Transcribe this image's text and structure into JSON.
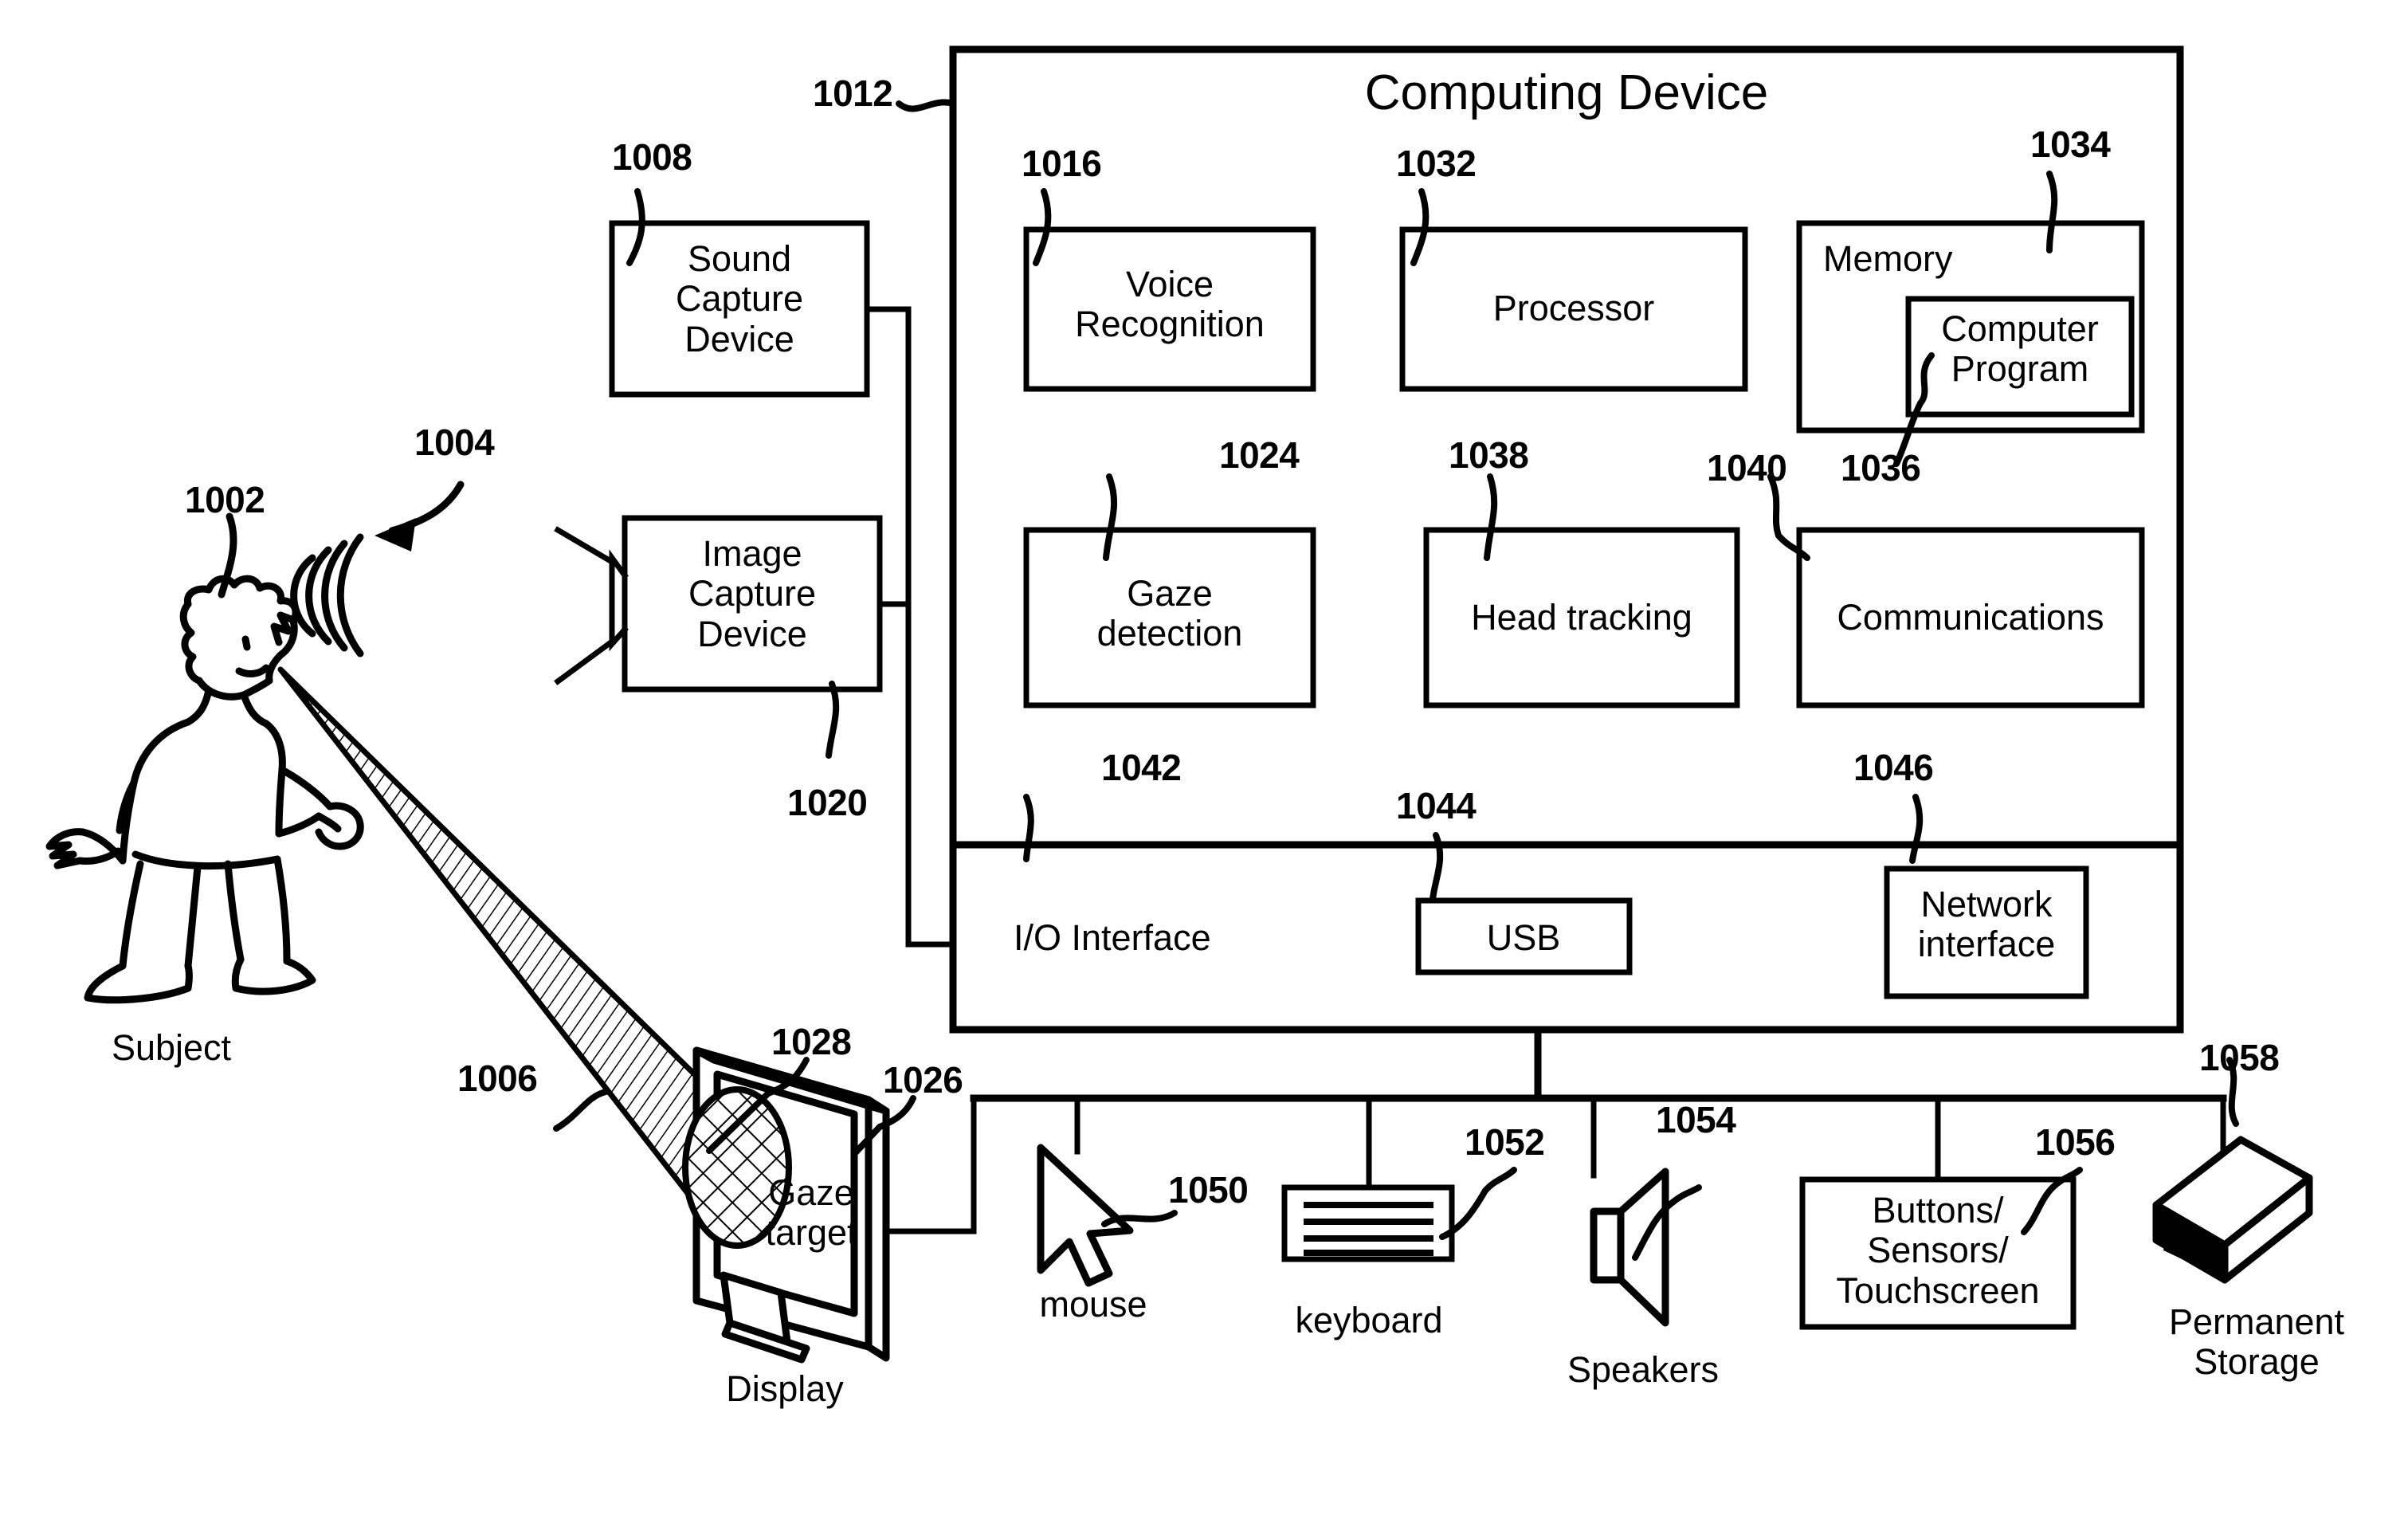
{
  "figure": {
    "title": "Computing Device",
    "subject_label": "Subject",
    "display_label": "Display",
    "gaze_target_label": "Gaze\ntarget"
  },
  "computing_device": {
    "title": "Computing Device",
    "ref": "1012",
    "modules": [
      {
        "label": "Voice\nRecognition",
        "ref": "1016"
      },
      {
        "label": "Processor",
        "ref": "1032"
      },
      {
        "label": "Memory",
        "ref": "1034"
      },
      {
        "label": "Computer\nProgram",
        "ref": "1036"
      },
      {
        "label": "Gaze\ndetection",
        "ref": "1024"
      },
      {
        "label": "Head tracking",
        "ref": "1038"
      },
      {
        "label": "Communications",
        "ref": "1040"
      }
    ],
    "io_section": {
      "label": "I/O Interface",
      "ref": "1042",
      "items": [
        {
          "label": "USB",
          "ref": "1044"
        },
        {
          "label": "Network\ninterface",
          "ref": "1046"
        }
      ]
    }
  },
  "capture_devices": [
    {
      "label": "Sound\nCapture\nDevice",
      "ref": "1008",
      "icon": "sound-capture-box"
    },
    {
      "label": "Image\nCapture\nDevice",
      "ref": "1020",
      "icon": "camera-lens-icon"
    }
  ],
  "scene": {
    "subject": {
      "label": "Subject",
      "ref": "1002",
      "icon": "person-figure-icon"
    },
    "sound_waves": {
      "ref": "1004",
      "icon": "sound-waves-icon"
    },
    "gaze_cone": {
      "ref": "1006",
      "icon": "gaze-cone-icon"
    },
    "gaze_target": {
      "label": "Gaze\ntarget",
      "ref": "1028",
      "icon": "gaze-target-ellipse-icon"
    },
    "display": {
      "label": "Display",
      "ref": "1026",
      "icon": "monitor-icon"
    }
  },
  "peripherals": [
    {
      "label": "mouse",
      "ref": "1050",
      "icon": "mouse-cursor-icon"
    },
    {
      "label": "keyboard",
      "ref": "1052",
      "icon": "keyboard-icon"
    },
    {
      "label": "Speakers",
      "ref": "1054",
      "icon": "speaker-icon"
    },
    {
      "label": "Buttons/\nSensors/\nTouchscreen",
      "ref": "1056",
      "icon": "buttons-sensors-box"
    },
    {
      "label": "Permanent\nStorage",
      "ref": "1058",
      "icon": "storage-drive-icon"
    }
  ],
  "colors": {
    "ink": "#000000",
    "paper": "#ffffff"
  }
}
